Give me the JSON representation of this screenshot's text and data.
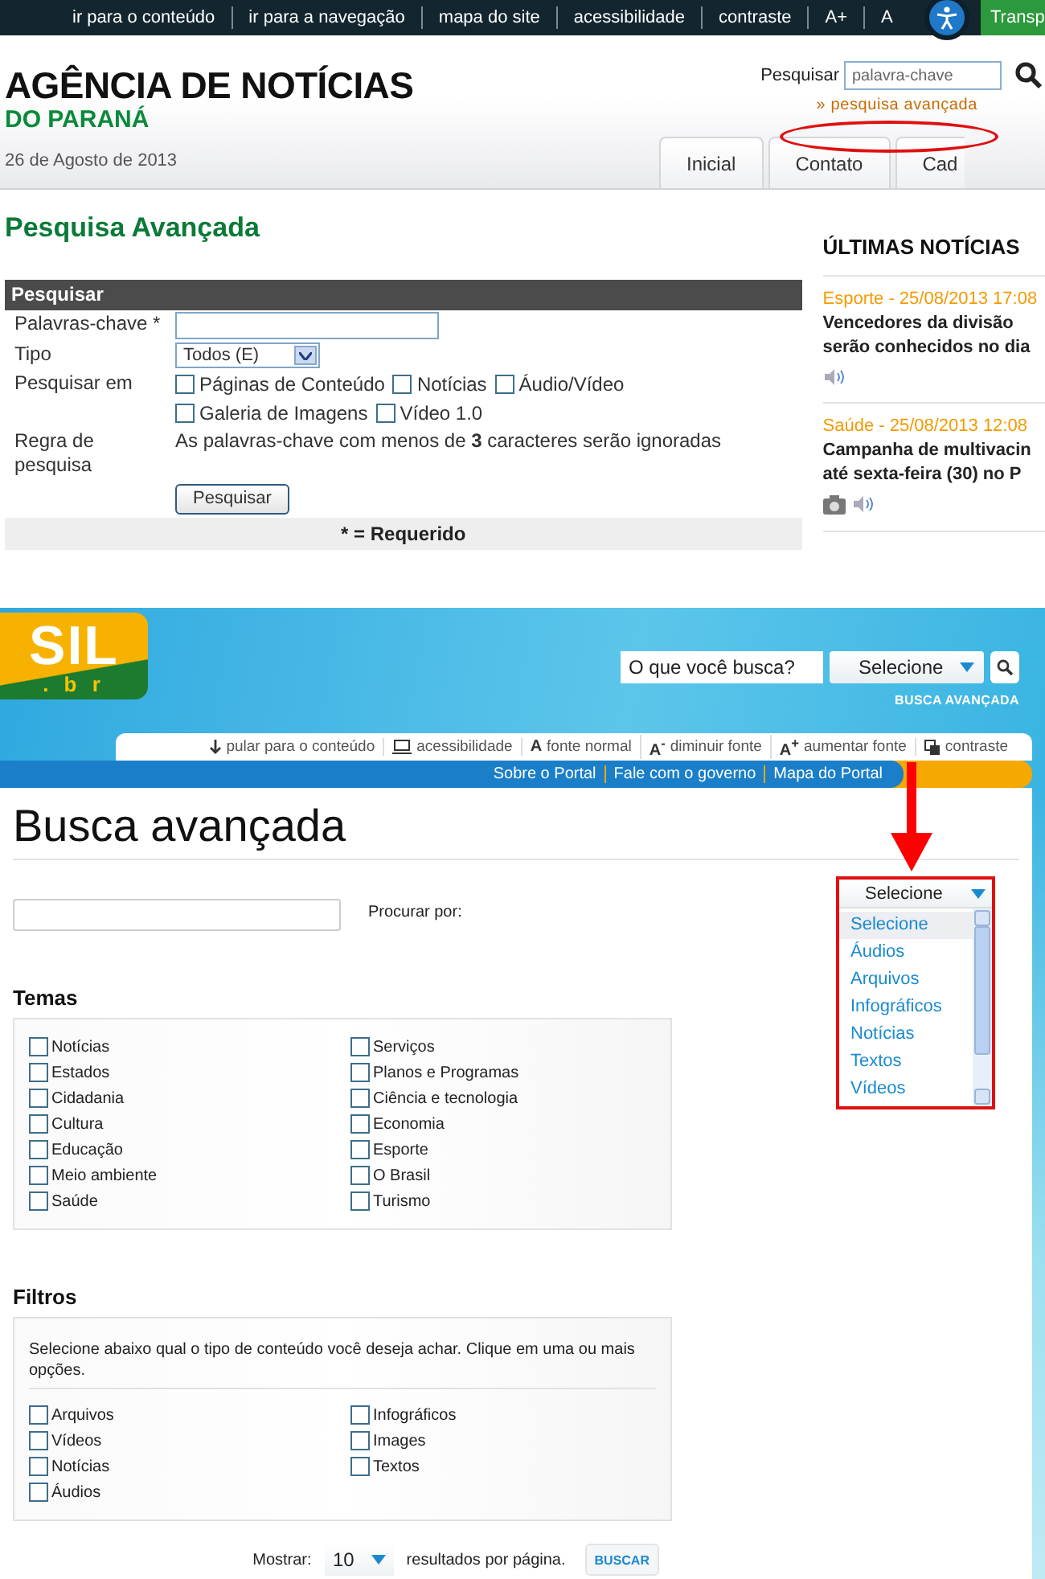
{
  "agency": {
    "nav_links": [
      "ir para o conteúdo",
      "ir para a navegação",
      "mapa do site",
      "acessibilidade",
      "contraste",
      "A+",
      "A"
    ],
    "transparency_tab": "Transp",
    "title": "AGÊNCIA DE NOTÍCIAS",
    "subtitle": "DO PARANÁ",
    "date": "26 de Agosto de 2013",
    "search": {
      "label": "Pesquisar",
      "placeholder": "palavra-chave"
    },
    "advanced_link": "» pesquisa avançada",
    "tabs": [
      "Inicial",
      "Contato",
      "Cad"
    ],
    "page_title": "Pesquisa Avançada",
    "form": {
      "header": "Pesquisar",
      "rows": [
        {
          "kind": "input",
          "label": "Palavras-chave *"
        },
        {
          "kind": "select",
          "label": "Tipo",
          "value": "Todos (E)"
        },
        {
          "kind": "checks",
          "label": "Pesquisar em",
          "options": [
            {
              "label": "Páginas de Conteúdo",
              "checked": false
            },
            {
              "label": "Notícias",
              "checked": false
            },
            {
              "label": "Áudio/Vídeo",
              "checked": false
            },
            {
              "label": "Galeria de Imagens",
              "checked": false
            },
            {
              "label": "Vídeo 1.0",
              "checked": false
            }
          ]
        },
        {
          "kind": "note",
          "label": "Regra de pesquisa",
          "text": "As palavras-chave com menos de **3** caracteres serão ignoradas"
        }
      ],
      "button": "Pesquisar",
      "footnote": "* = Requerido"
    },
    "latest": {
      "title": "ÚLTIMAS NOTÍCIAS",
      "items": [
        {
          "meta": "Esporte - 25/08/2013 17:08",
          "lines": [
            "Vencedores da divisão",
            "serão conhecidos no dia"
          ],
          "media": [
            {
              "kind": "audio"
            }
          ]
        },
        {
          "meta": "Saúde - 25/08/2013 12:08",
          "lines": [
            "Campanha de multivacin",
            "até sexta-feira (30) no P"
          ],
          "media": [
            {
              "kind": "photo"
            },
            {
              "kind": "audio"
            }
          ]
        }
      ]
    }
  },
  "portal": {
    "logo": {
      "main": "SIL",
      "suffix": ". b r"
    },
    "search": {
      "placeholder": "O que você busca?"
    },
    "type_select": "Selecione",
    "advanced_link": "BUSCA AVANÇADA",
    "tools": [
      {
        "kind": "skip",
        "label": "pular para o conteúdo"
      },
      {
        "kind": "access",
        "label": "acessibilidade"
      },
      {
        "kind": "font",
        "glyph": "A",
        "label": "fonte normal"
      },
      {
        "kind": "font",
        "glyph": "A$^{-}$",
        "label": "diminuir fonte"
      },
      {
        "kind": "font",
        "glyph": "A$^{+}$",
        "label": "aumentar fonte"
      },
      {
        "kind": "contrast",
        "label": "contraste"
      }
    ],
    "links": [
      "Sobre o Portal",
      "Fale com o governo",
      "Mapa do Portal"
    ],
    "page_title": "Busca avançada",
    "query_label": "Procurar por:",
    "type_dropdown": {
      "value": "Selecione",
      "options": [
        {
          "label": "Selecione",
          "selected": true
        },
        {
          "label": "Áudios",
          "selected": false
        },
        {
          "label": "Arquivos",
          "selected": false
        },
        {
          "label": "Infográficos",
          "selected": false
        },
        {
          "label": "Notícias",
          "selected": false
        },
        {
          "label": "Textos",
          "selected": false
        },
        {
          "label": "Vídeos",
          "selected": false
        }
      ]
    },
    "themes": {
      "title": "Temas",
      "columns": [
        [
          {
            "label": "Notícias",
            "checked": false
          },
          {
            "label": "Estados",
            "checked": false
          },
          {
            "label": "Cidadania",
            "checked": false
          },
          {
            "label": "Cultura",
            "checked": false
          },
          {
            "label": "Educação",
            "checked": false
          },
          {
            "label": "Meio ambiente",
            "checked": false
          },
          {
            "label": "Saúde",
            "checked": false
          }
        ],
        [
          {
            "label": "Serviços",
            "checked": false
          },
          {
            "label": "Planos e Programas",
            "checked": false
          },
          {
            "label": "Ciência e tecnologia",
            "checked": false
          },
          {
            "label": "Economia",
            "checked": false
          },
          {
            "label": "Esporte",
            "checked": false
          },
          {
            "label": "O Brasil",
            "checked": false
          },
          {
            "label": "Turismo",
            "checked": false
          }
        ]
      ]
    },
    "filters": {
      "title": "Filtros",
      "description": "Selecione abaixo qual o tipo de conteúdo você deseja achar. Clique em uma ou mais opções.",
      "columns": [
        [
          {
            "label": "Arquivos",
            "checked": false
          },
          {
            "label": "Vídeos",
            "checked": false
          },
          {
            "label": "Notícias",
            "checked": false
          },
          {
            "label": "Áudios",
            "checked": false
          }
        ],
        [
          {
            "label": "Infográficos",
            "checked": false
          },
          {
            "label": "Images",
            "checked": false
          },
          {
            "label": "Textos",
            "checked": false
          }
        ]
      ]
    },
    "paging": {
      "label": "Mostrar:",
      "value": "10",
      "suffix": "resultados por página.",
      "button": "BUSCAR"
    }
  }
}
